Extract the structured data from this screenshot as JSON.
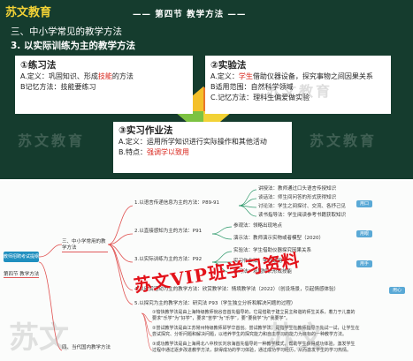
{
  "slide": {
    "brand": "苏文教育",
    "section_title": "—— 第四节  教学方法 ——",
    "heading_2": "三、中小学常见的教学方法",
    "heading_3": "3. 以实际训练为主的教学方法",
    "box1": {
      "title": "①练习法",
      "definition_prefix": "A.定义：巩固知识、形成",
      "definition_highlight": "技能",
      "definition_suffix": "的方法",
      "memory": "B记忆方法：技能要练习"
    },
    "box2": {
      "title": "②实验法",
      "definition_prefix": "A.定义：",
      "definition_highlight": "学生",
      "definition_suffix": "借助仪器设备，探究事物之间因果关系",
      "scope": "B适用范围：自然科学领域",
      "memory": "C.记忆方法：理科生偏爱做实验"
    },
    "box3": {
      "title": "③实习作业法",
      "definition": "A.定义：运用所学知识进行实际操作和其他活动",
      "feature_prefix": "B.特点：",
      "feature_highlight": "强调学以致用"
    },
    "watermark": "苏文教育"
  },
  "mindmap": {
    "root": "教师招聘考试提纲",
    "section": "第四节 教学方法",
    "chapter": "三、中小学常用的教学方法",
    "branches": [
      {
        "label": "1.以语言传递信息为主的方法：P89-91",
        "children": [
          "讲授法：教师通过口头语言传授知识",
          "谈话法：师生间问答的形式获得知识",
          "讨论法：学生之间探讨、交流、各抒己见",
          "读书指导法：学生阅读参考书籍获取知识"
        ],
        "tag": "用口"
      },
      {
        "label": "2.以直接感知为主的方法：P91",
        "children": [
          "参观法：领略出现地点",
          "演示法：教师演示实物或者模型（2020）"
        ],
        "tag": "用眼"
      },
      {
        "label": "3.以实际训练为主的方法：P92",
        "children": [
          "实验法：学生借助仪器探究因果关系",
          "实习作业法：学以致用",
          "练习法：巩固知识形成技能"
        ],
        "tag": "用手"
      },
      {
        "label": "4.以欣赏活动为主的教学方法：欣赏教学法：情境教学法（2022）（创设场景，引起情感体验）",
        "children": [],
        "tag": "用心"
      },
      {
        "label": "5.以探究为主的教学方法：研究法 P93（学生独立分析和解决问题的过程）",
        "children": [],
        "tag": ""
      },
      {
        "label": "四、当代国内教学方法",
        "children": [],
        "tag": ""
      }
    ],
    "paragraphs": [
      "①愉快教学法是由上海特级教师倪谷音首先倡导的，它是借助于建立民主和谐的师生关系，着力于儿童的",
      "要求“乐学”为“好学”，要求“苦学”为“乐学”，要“要我学”为“我要学”。",
      "②尝试教学法是由江苏常州特级教师邱学华首创。尝试教学法，是指学生在教师指导下先试一试，让学生在",
      "尝试探究、分析问题和解决问题，以培养学生的探究能力和自主学习的能力为目标的一种教学方法。",
      "③成功教学法是由上海闸北八中校长刘京海首先倡导的一种教学模式，帮助学生获得成功体验，激发学生",
      "过程中通过逐步改进教学方法，获得成功的学习体验，通过成功学习经历，从而激发学生的学习热情。"
    ],
    "stamp": "苏文VIP班学习资料",
    "watermark": "苏文"
  },
  "colors": {
    "slide_bg": "#153c2e",
    "brand_yellow": "#f2d236",
    "highlight_red": "#d9261c",
    "tag_blue": "#5aa9d6",
    "stamp_red": "#e3121a"
  }
}
